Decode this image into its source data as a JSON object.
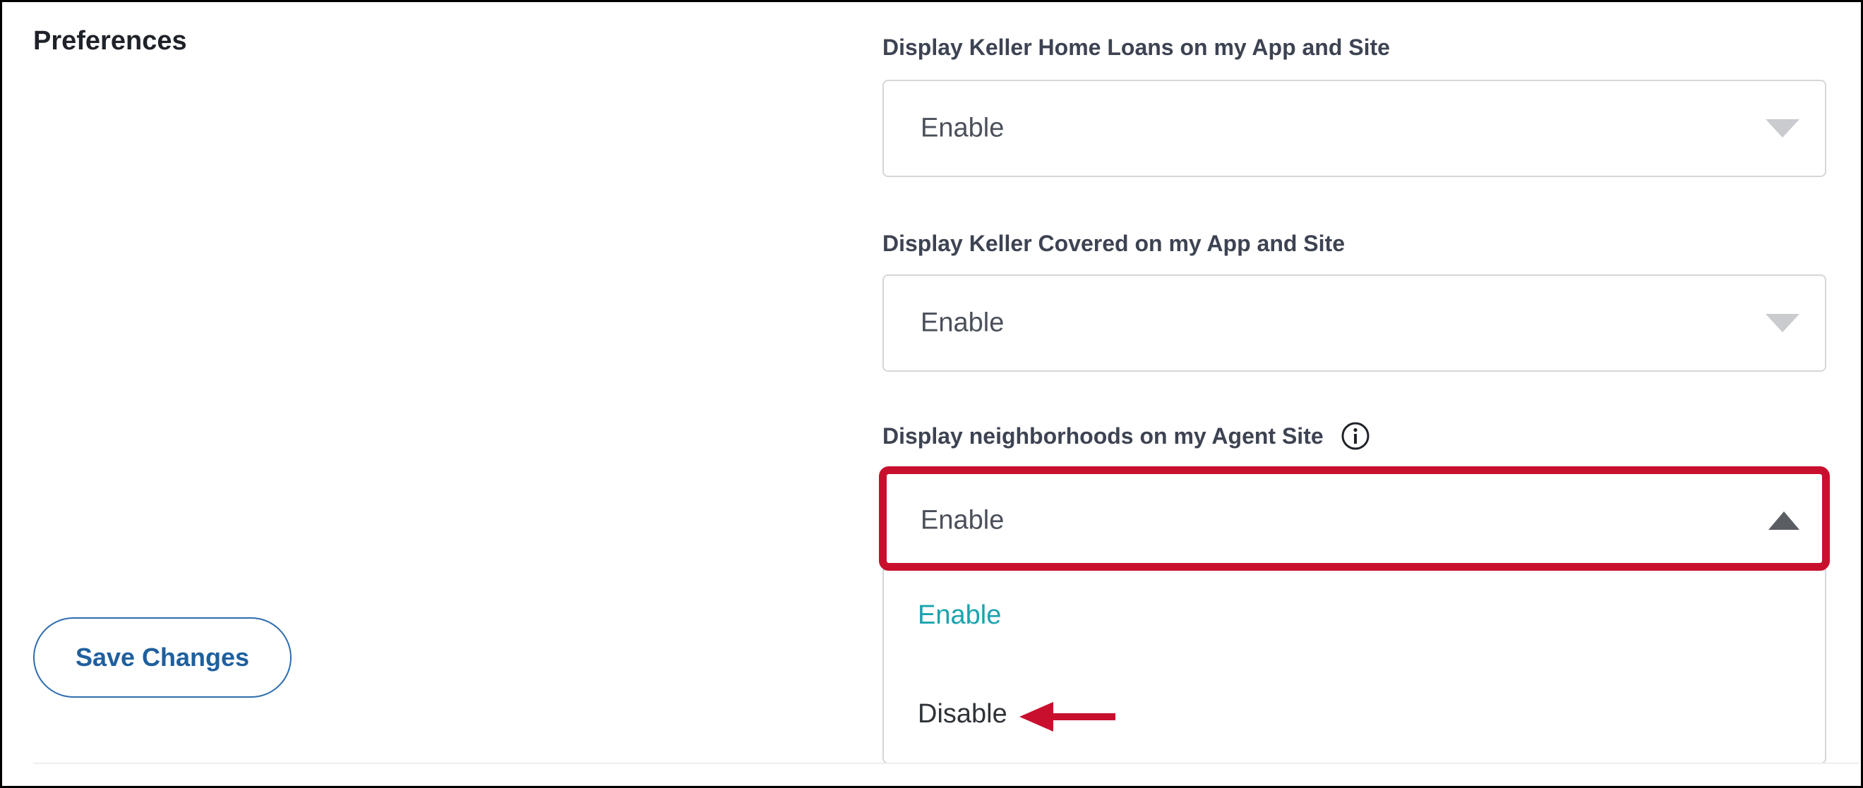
{
  "preferences": {
    "section_title": "Preferences",
    "save_button_label": "Save Changes",
    "fields": [
      {
        "label": "Display Keller Home Loans on my App and Site",
        "value": "Enable",
        "state": "collapsed"
      },
      {
        "label": "Display Keller Covered on my App and Site",
        "value": "Enable",
        "state": "collapsed"
      },
      {
        "label": "Display neighborhoods on my Agent Site",
        "value": "Enable",
        "state": "expanded",
        "has_info_icon": true
      }
    ],
    "dropdown_options": [
      {
        "label": "Enable",
        "selected": true
      },
      {
        "label": "Disable",
        "selected": false
      }
    ]
  },
  "colors": {
    "highlight": "#c8102e",
    "selected_option": "#1aa3ad",
    "button_text": "#1f5f9e",
    "button_border": "#2d6cae"
  },
  "icons": {
    "info": "info-circle-icon",
    "collapsed_caret": "chevron-down-icon",
    "expanded_caret": "chevron-up-icon",
    "annotation": "red-arrow-left-icon"
  }
}
